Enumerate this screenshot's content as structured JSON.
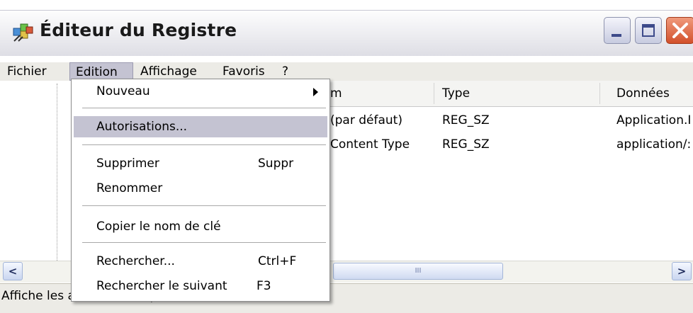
{
  "window": {
    "title": "Éditeur du Registre",
    "icon": "registry-editor-icon",
    "accent_close": "#d2502b"
  },
  "menubar": {
    "items": [
      "Fichier",
      "Edition",
      "Affichage",
      "Favoris",
      "?"
    ],
    "active": "Edition"
  },
  "list": {
    "columns": [
      "m",
      "Type",
      "Données"
    ],
    "rows": [
      [
        "(par défaut)",
        "REG_SZ",
        "Application.I"
      ],
      [
        "Content Type",
        "REG_SZ",
        "application/:"
      ]
    ]
  },
  "edit_menu": {
    "items": [
      {
        "label": "Nouveau",
        "shortcut": "",
        "submenu": true
      },
      {
        "label": "Autorisations...",
        "shortcut": "",
        "highlighted": true
      },
      {
        "label": "Supprimer",
        "shortcut": "Suppr"
      },
      {
        "label": "Renommer",
        "shortcut": ""
      },
      {
        "label": "Copier le nom de clé",
        "shortcut": ""
      },
      {
        "label": "Rechercher...",
        "shortcut": "Ctrl+F"
      },
      {
        "label": "Rechercher le suivant",
        "shortcut": "F3"
      }
    ]
  },
  "scrollbar": {
    "left_arrow": "<",
    "right_arrow": ">",
    "thumb_grip": "III"
  },
  "statusbar": {
    "text": "Affiche les autorisations pour une clé."
  }
}
